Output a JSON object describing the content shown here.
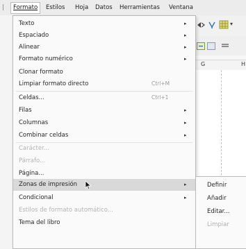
{
  "menubar": {
    "items": [
      "Formato",
      "Estilos",
      "Hoja",
      "Datos",
      "Herramientas",
      "Ventana"
    ]
  },
  "spreadsheet": {
    "columns": [
      "G",
      "H"
    ]
  },
  "format_menu": {
    "items": [
      {
        "label": "Texto",
        "submenu": true
      },
      {
        "label": "Espaciado",
        "submenu": true
      },
      {
        "label": "Alinear",
        "submenu": true
      },
      {
        "label": "Formato numérico",
        "submenu": true
      },
      {
        "label": "Clonar formato"
      },
      {
        "label": "Limpiar formato directo",
        "shortcut": "Ctrl+M"
      },
      {
        "label": "Celdas...",
        "shortcut": "Ctrl+1"
      },
      {
        "label": "Filas",
        "submenu": true
      },
      {
        "label": "Columnas",
        "submenu": true
      },
      {
        "label": "Combinar celdas",
        "submenu": true
      },
      {
        "label": "Carácter...",
        "disabled": true
      },
      {
        "label": "Párrafo...",
        "disabled": true
      },
      {
        "label": "Página..."
      },
      {
        "label": "Zonas de impresión",
        "submenu": true,
        "highlighted": true
      },
      {
        "label": "Condicional",
        "submenu": true
      },
      {
        "label": "Estilos de formato automático...",
        "disabled": true
      },
      {
        "label": "Tema del libro"
      }
    ]
  },
  "print_ranges_submenu": {
    "items": [
      {
        "label": "Definir"
      },
      {
        "label": "Añadir"
      },
      {
        "label": "Editar..."
      },
      {
        "label": "Limpiar",
        "disabled": true
      }
    ]
  },
  "icons": {
    "submenu_arrow": "chevron-right-icon",
    "cursor": "mouse-pointer-icon"
  },
  "colors": {
    "highlight": "#d9d9d9",
    "menu_bg": "#fafafa",
    "disabled_text": "#b4b4b4"
  }
}
